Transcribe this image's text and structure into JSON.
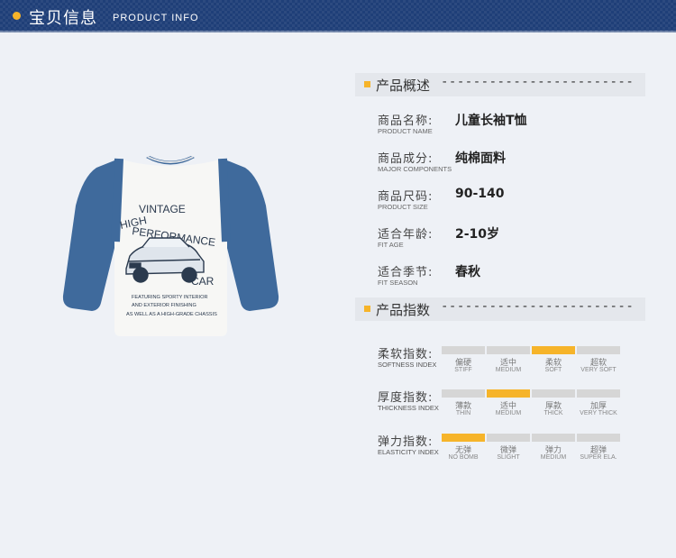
{
  "header": {
    "title_cn": "宝贝信息",
    "title_en": "PRODUCT INFO"
  },
  "shirt": {
    "print_lines": [
      "VINTAGE",
      "HIGH",
      "PERFORMANCE",
      "CAR",
      "FEATURING SPORTY INTERIOR",
      "AND EXTERIOR FINISHING",
      "AS WELL AS A HIGH-GRADE CHASSIS"
    ]
  },
  "overview": {
    "title": "产品概述",
    "dashes": "------------------------",
    "rows": [
      {
        "label_cn": "商品名称:",
        "label_en": "PRODUCT NAME",
        "value": "儿童长袖T恤"
      },
      {
        "label_cn": "商品成分:",
        "label_en": "MAJOR COMPONENTS",
        "value": "纯棉面料"
      },
      {
        "label_cn": "商品尺码:",
        "label_en": "PRODUCT SIZE",
        "value": "90-140"
      },
      {
        "label_cn": "适合年龄:",
        "label_en": "FIT AGE",
        "value": "2-10岁"
      },
      {
        "label_cn": "适合季节:",
        "label_en": "FIT SEASON",
        "value": "春秋"
      }
    ]
  },
  "indices": {
    "title": "产品指数",
    "dashes": "------------------------",
    "rows": [
      {
        "label_cn": "柔软指数:",
        "label_en": "SOFTNESS INDEX",
        "active": 2,
        "options": [
          {
            "cn": "偏硬",
            "en": "STIFF"
          },
          {
            "cn": "适中",
            "en": "MEDIUM"
          },
          {
            "cn": "柔软",
            "en": "SOFT"
          },
          {
            "cn": "超软",
            "en": "VERY SOFT"
          }
        ]
      },
      {
        "label_cn": "厚度指数:",
        "label_en": "THICKNESS INDEX",
        "active": 1,
        "options": [
          {
            "cn": "薄款",
            "en": "THIN"
          },
          {
            "cn": "适中",
            "en": "MEDIUM"
          },
          {
            "cn": "厚款",
            "en": "THICK"
          },
          {
            "cn": "加厚",
            "en": "VERY THICK"
          }
        ]
      },
      {
        "label_cn": "弹力指数:",
        "label_en": "ELASTICITY INDEX",
        "active": 0,
        "options": [
          {
            "cn": "无弹",
            "en": "NO BOMB"
          },
          {
            "cn": "微弹",
            "en": "SLIGHT"
          },
          {
            "cn": "弹力",
            "en": "MEDIUM"
          },
          {
            "cn": "超弹",
            "en": "SUPER ELA."
          }
        ]
      }
    ]
  },
  "colors": {
    "header_bg": "#1f3f78",
    "accent": "#f6b42a",
    "sleeve": "#3f6a9c",
    "body": "#f7f7f5"
  }
}
